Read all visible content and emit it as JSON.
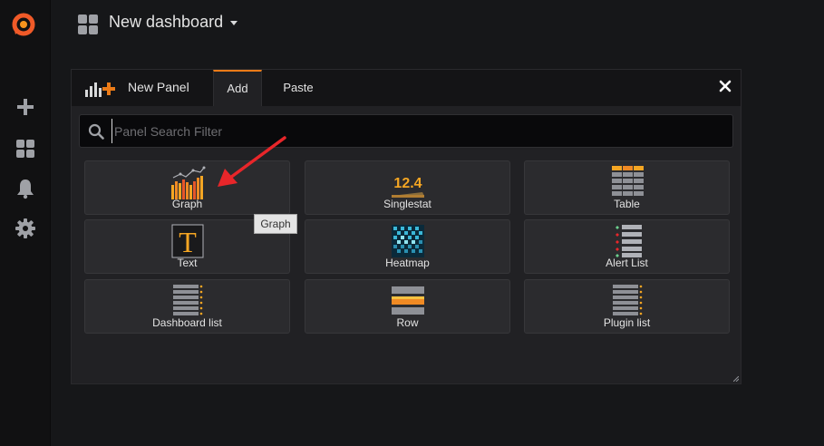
{
  "topbar": {
    "title": "New dashboard"
  },
  "panel": {
    "title": "New Panel",
    "tabs": [
      {
        "label": "Add",
        "active": true
      },
      {
        "label": "Paste",
        "active": false
      }
    ],
    "search": {
      "placeholder": "Panel Search Filter",
      "value": ""
    },
    "items": [
      {
        "label": "Graph",
        "icon": "graph-icon"
      },
      {
        "label": "Singlestat",
        "icon": "singlestat-icon",
        "icon_text": "12.4"
      },
      {
        "label": "Table",
        "icon": "table-icon"
      },
      {
        "label": "Text",
        "icon": "text-icon",
        "icon_text": "T"
      },
      {
        "label": "Heatmap",
        "icon": "heatmap-icon"
      },
      {
        "label": "Alert List",
        "icon": "alert-list-icon"
      },
      {
        "label": "Dashboard list",
        "icon": "dashboard-list-icon"
      },
      {
        "label": "Row",
        "icon": "row-icon"
      },
      {
        "label": "Plugin list",
        "icon": "plugin-list-icon"
      }
    ]
  },
  "tooltip": {
    "text": "Graph"
  },
  "colors": {
    "accent": "#eb7b18",
    "annotation_arrow": "#e8262a"
  }
}
